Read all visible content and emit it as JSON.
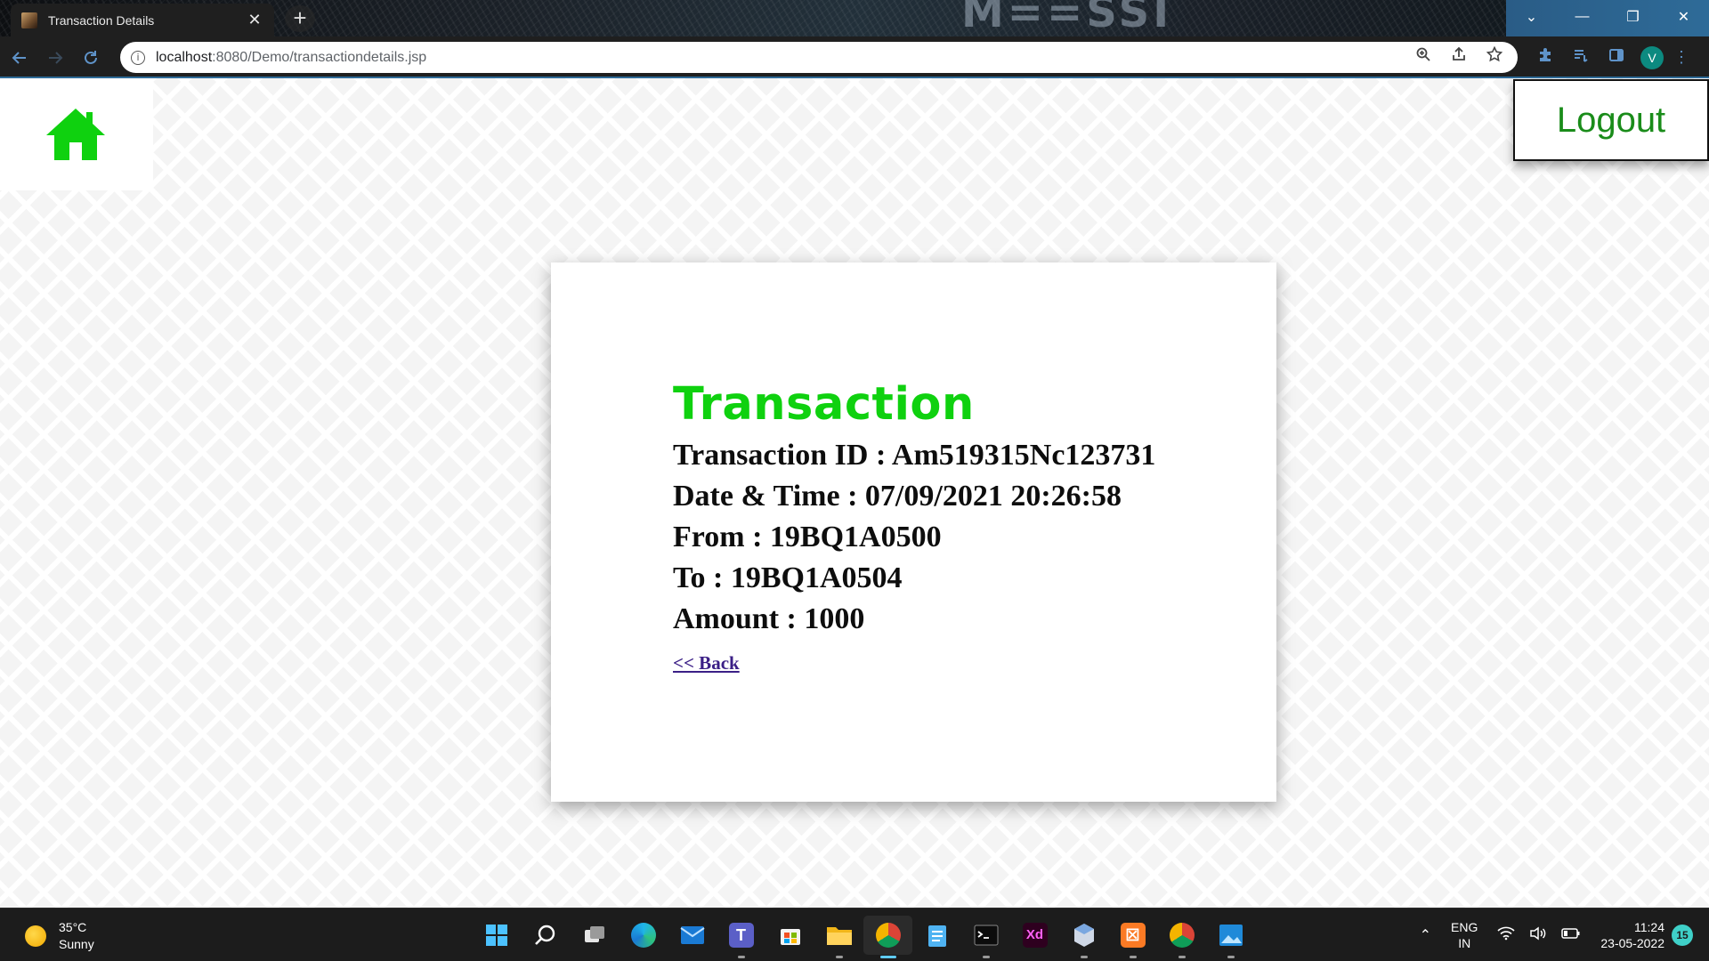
{
  "browser": {
    "tab_title": "Transaction Details",
    "tab_close": "✕",
    "new_tab": "+",
    "url_host": "localhost",
    "url_path": ":8080/Demo/transactiondetails.jsp",
    "profile_initial": "V",
    "window_controls": {
      "minimize": "—",
      "restore": "❐",
      "close": "✕",
      "dropdown": "⌄"
    },
    "wallpaper_text": "M==SSI"
  },
  "page": {
    "logout_label": "Logout",
    "home_icon": "home-icon",
    "accent_color": "#0fd10f",
    "transaction": {
      "heading": "Transaction",
      "transaction_id": "Transaction ID : Am519315Nc123731",
      "date_time": "Date & Time : 07/09/2021 20:26:58",
      "from": "From : 19BQ1A0500",
      "to": "To : 19BQ1A0504",
      "amount": "Amount : 1000",
      "back_link": "<< Back"
    }
  },
  "taskbar": {
    "weather_temp": "35°C",
    "weather_desc": "Sunny",
    "apps": [
      "start-icon",
      "search-icon",
      "task-view-icon",
      "edge-icon",
      "mail-icon",
      "teams-icon",
      "store-icon",
      "file-explorer-icon",
      "chrome-icon",
      "notepad-icon",
      "terminal-icon",
      "xd-icon",
      "box-app-icon",
      "xampp-icon",
      "chrome-profile-icon",
      "photos-icon"
    ],
    "language": "ENG",
    "region": "IN",
    "time": "11:24",
    "date": "23-05-2022",
    "notification_count": "15"
  }
}
